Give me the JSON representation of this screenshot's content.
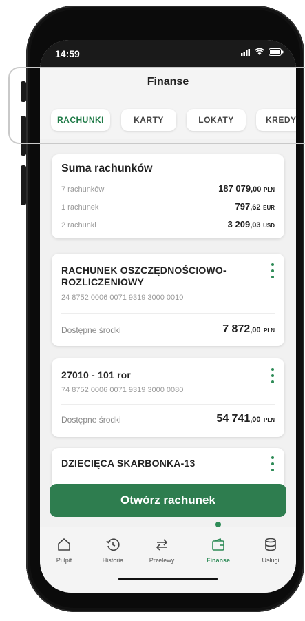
{
  "status": {
    "time": "14:59"
  },
  "header": {
    "title": "Finanse"
  },
  "tabs": [
    {
      "label": "RACHUNKI",
      "active": true
    },
    {
      "label": "KARTY",
      "active": false
    },
    {
      "label": "LOKATY",
      "active": false
    },
    {
      "label": "KREDYTY",
      "active": false
    }
  ],
  "summary": {
    "title": "Suma rachunków",
    "rows": [
      {
        "label": "7 rachunków",
        "int": "187 079",
        "dec": ",00",
        "currency": "PLN"
      },
      {
        "label": "1 rachunek",
        "int": "797",
        "dec": ",62",
        "currency": "EUR"
      },
      {
        "label": "2 rachunki",
        "int": "3 209",
        "dec": ",03",
        "currency": "USD"
      }
    ]
  },
  "accounts": [
    {
      "name": "RACHUNEK OSZCZĘDNOŚCIOWO-ROZLICZENIOWY",
      "number": "24 8752 0006 0071 9319 3000 0010",
      "available_label": "Dostępne środki",
      "int": "7 872",
      "dec": ",00",
      "currency": "PLN"
    },
    {
      "name": "27010 - 101 ror",
      "number": "74 8752 0006 0071 9319 3000 0080",
      "available_label": "Dostępne środki",
      "int": "54 741",
      "dec": ",00",
      "currency": "PLN"
    },
    {
      "name": "DZIECIĘCA SKARBONKA-13"
    }
  ],
  "actions": {
    "open_account": "Otwórz rachunek"
  },
  "nav": [
    {
      "label": "Pulpit",
      "icon": "home-icon"
    },
    {
      "label": "Historia",
      "icon": "history-icon"
    },
    {
      "label": "Przelewy",
      "icon": "transfer-icon"
    },
    {
      "label": "Finanse",
      "icon": "wallet-icon",
      "active": true
    },
    {
      "label": "Usługi",
      "icon": "database-icon"
    }
  ],
  "colors": {
    "accent": "#2e7d4f",
    "tab_active": "#1f7a47"
  }
}
